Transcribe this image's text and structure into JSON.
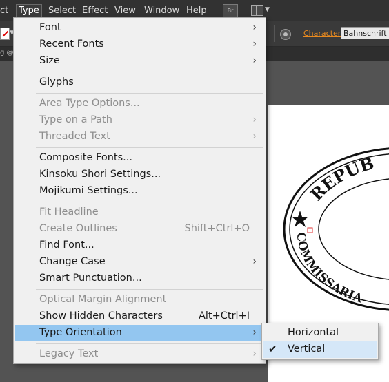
{
  "menubar": {
    "items": [
      "ct",
      "Type",
      "Select",
      "Effect",
      "View",
      "Window",
      "Help"
    ],
    "active": "Type",
    "bridge_label": "Br"
  },
  "toolbar": {
    "character_label": "Character:",
    "font_value": "Bahnschrift"
  },
  "document_tab": {
    "label": "g @"
  },
  "type_menu": {
    "items": [
      {
        "label": "Font",
        "submenu": true
      },
      {
        "label": "Recent Fonts",
        "submenu": true
      },
      {
        "label": "Size",
        "submenu": true
      },
      {
        "label": "Glyphs"
      },
      {
        "label": "Area Type Options...",
        "disabled": true
      },
      {
        "label": "Type on a Path",
        "disabled": true,
        "submenu": true
      },
      {
        "label": "Threaded Text",
        "disabled": true,
        "submenu": true
      },
      {
        "label": "Composite Fonts..."
      },
      {
        "label": "Kinsoku Shori Settings..."
      },
      {
        "label": "Mojikumi Settings..."
      },
      {
        "label": "Fit Headline",
        "disabled": true
      },
      {
        "label": "Create Outlines",
        "disabled": true,
        "shortcut": "Shift+Ctrl+O"
      },
      {
        "label": "Find Font..."
      },
      {
        "label": "Change Case",
        "submenu": true
      },
      {
        "label": "Smart Punctuation..."
      },
      {
        "label": "Optical Margin Alignment",
        "disabled": true
      },
      {
        "label": "Show Hidden Characters",
        "shortcut": "Alt+Ctrl+I"
      },
      {
        "label": "Type Orientation",
        "submenu": true,
        "highlighted": true
      },
      {
        "label": "Legacy Text",
        "disabled": true,
        "submenu": true
      }
    ]
  },
  "orientation_submenu": {
    "items": [
      {
        "label": "Horizontal",
        "checked": false
      },
      {
        "label": "Vertical",
        "checked": true
      }
    ]
  },
  "artwork": {
    "top_text": "REPUB",
    "side_text": "COMMISSARIA"
  }
}
